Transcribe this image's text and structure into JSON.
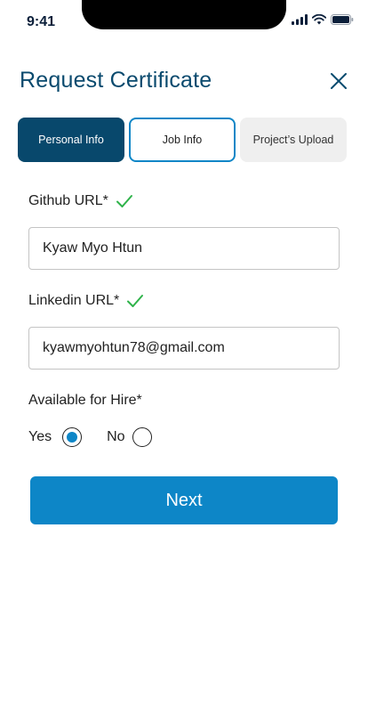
{
  "status_bar": {
    "time": "9:41"
  },
  "header": {
    "title": "Request Certificate"
  },
  "tabs": [
    {
      "label": "Personal Info"
    },
    {
      "label": "Job Info"
    },
    {
      "label": "Project’s Upload"
    }
  ],
  "form": {
    "github": {
      "label": "Github URL*",
      "value": "Kyaw Myo Htun"
    },
    "linkedin": {
      "label": "Linkedin URL*",
      "value": "kyawmyohtun78@gmail.com"
    },
    "hire": {
      "label": "Available for Hire*",
      "options": [
        {
          "label": "Yes",
          "selected": true
        },
        {
          "label": "No",
          "selected": false
        }
      ]
    }
  },
  "actions": {
    "next_label": "Next"
  },
  "colors": {
    "primary": "#0d86c7",
    "dark": "#08486c",
    "title": "#0a4a6e",
    "check": "#2fb34a"
  }
}
